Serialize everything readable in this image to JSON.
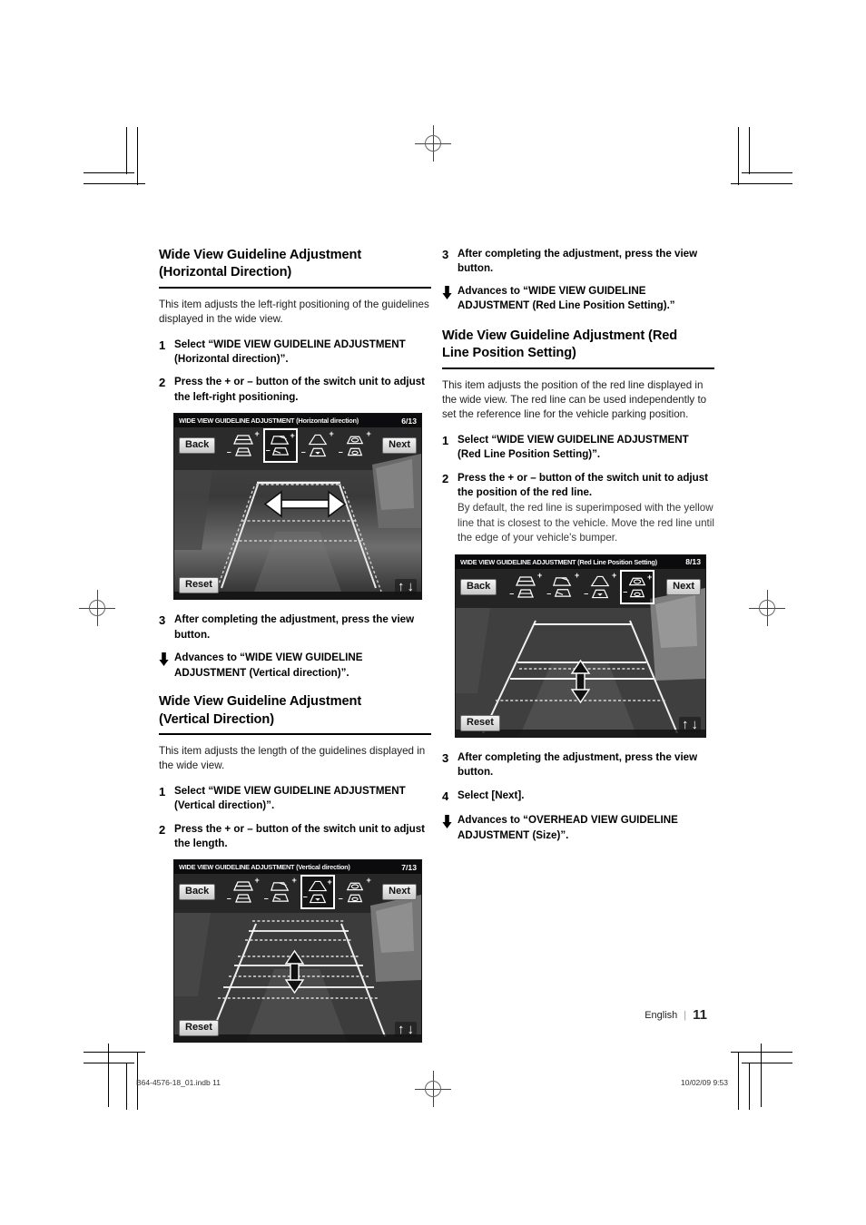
{
  "document": {
    "language_label": "English",
    "page_number": "11",
    "print_file": "B64-4576-18_01.indb  11",
    "print_timestamp": "10/02/09   9:53"
  },
  "left_column": {
    "section1": {
      "heading_line1": "Wide View Guideline Adjustment",
      "heading_line2": "(Horizontal Direction)",
      "intro": "This item adjusts the left-right positioning of the guidelines displayed in the wide view.",
      "steps": [
        {
          "num": "1",
          "text": "Select “WIDE VIEW GUIDELINE ADJUSTMENT (Horizontal direction)”."
        },
        {
          "num": "2",
          "text": "Press the + or – button of the switch unit to adjust the left-right positioning."
        }
      ],
      "screenshot": {
        "title_main": "WIDE VIEW GUIDELINE ADJUSTMENT",
        "title_sub": "(Horizontal direction)",
        "page_indicator": "6/13",
        "back_label": "Back",
        "next_label": "Next",
        "reset_label": "Reset",
        "up_arrow": "↑",
        "down_arrow": "↓",
        "selected_icon_index": 1,
        "arrow_direction": "horizontal",
        "plus_label": "+",
        "minus_label": "–"
      },
      "step3": {
        "num": "3",
        "text": "After completing the adjustment, press the view button."
      },
      "advances": "Advances to “WIDE VIEW GUIDELINE ADJUSTMENT (Vertical direction)”."
    },
    "section2": {
      "heading_line1": "Wide View Guideline Adjustment",
      "heading_line2": "(Vertical Direction)",
      "intro": "This item adjusts the length of the guidelines displayed in the wide view.",
      "steps": [
        {
          "num": "1",
          "text": "Select “WIDE VIEW GUIDELINE ADJUSTMENT (Vertical direction)”."
        },
        {
          "num": "2",
          "text": "Press the + or – button of the switch unit to adjust the length."
        }
      ],
      "screenshot": {
        "title_main": "WIDE VIEW GUIDELINE ADJUSTMENT",
        "title_sub": "(Vertical direction)",
        "page_indicator": "7/13",
        "back_label": "Back",
        "next_label": "Next",
        "reset_label": "Reset",
        "up_arrow": "↑",
        "down_arrow": "↓",
        "selected_icon_index": 2,
        "arrow_direction": "vertical",
        "plus_label": "+",
        "minus_label": "–"
      }
    }
  },
  "right_column": {
    "top_step3": {
      "num": "3",
      "text": "After completing the adjustment, press the view button."
    },
    "top_advances": "Advances to “WIDE VIEW GUIDELINE ADJUSTMENT (Red Line Position Setting).”",
    "section3": {
      "heading_line1": "Wide View Guideline Adjustment (Red",
      "heading_line2": "Line Position Setting)",
      "intro": "This item adjusts the position of the red line displayed in the wide view. The red line can be used independently to set the reference line for the vehicle parking position.",
      "steps": [
        {
          "num": "1",
          "text": "Select “WIDE VIEW GUIDELINE ADJUSTMENT (Red Line Position Setting)”."
        },
        {
          "num": "2",
          "text": "Press the + or – button of the switch unit to adjust the position of the red line.",
          "sub": "By default, the red line is superimposed with the yellow line that is closest to the vehicle. Move the red line until the edge of your vehicle's bumper."
        }
      ],
      "screenshot": {
        "title_main": "WIDE VIEW GUIDELINE ADJUSTMENT",
        "title_sub": "(Red Line Position Setting)",
        "page_indicator": "8/13",
        "back_label": "Back",
        "next_label": "Next",
        "reset_label": "Reset",
        "up_arrow": "↑",
        "down_arrow": "↓",
        "selected_icon_index": 3,
        "arrow_direction": "vertical",
        "plus_label": "+",
        "minus_label": "–"
      },
      "step3": {
        "num": "3",
        "text": "After completing the adjustment, press the view button."
      },
      "step4": {
        "num": "4",
        "text": "Select [Next]."
      },
      "advances": "Advances to “OVERHEAD VIEW GUIDELINE ADJUSTMENT (Size)”."
    }
  },
  "colors": {
    "page_background": "#ffffff",
    "text": "#000000",
    "body_text": "#1b1b1b",
    "sub_text": "#3a3a3a",
    "rule": "#000000",
    "screen_dark": "#2a2a2a"
  }
}
